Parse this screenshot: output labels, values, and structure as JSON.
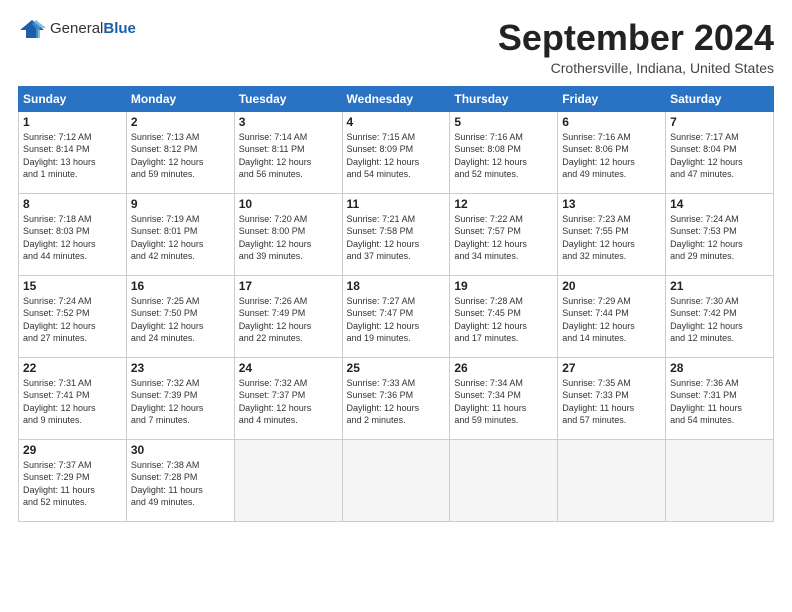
{
  "header": {
    "logo_general": "General",
    "logo_blue": "Blue",
    "month_title": "September 2024",
    "location": "Crothersville, Indiana, United States"
  },
  "weekdays": [
    "Sunday",
    "Monday",
    "Tuesday",
    "Wednesday",
    "Thursday",
    "Friday",
    "Saturday"
  ],
  "weeks": [
    [
      {
        "day": "1",
        "info": "Sunrise: 7:12 AM\nSunset: 8:14 PM\nDaylight: 13 hours\nand 1 minute."
      },
      {
        "day": "2",
        "info": "Sunrise: 7:13 AM\nSunset: 8:12 PM\nDaylight: 12 hours\nand 59 minutes."
      },
      {
        "day": "3",
        "info": "Sunrise: 7:14 AM\nSunset: 8:11 PM\nDaylight: 12 hours\nand 56 minutes."
      },
      {
        "day": "4",
        "info": "Sunrise: 7:15 AM\nSunset: 8:09 PM\nDaylight: 12 hours\nand 54 minutes."
      },
      {
        "day": "5",
        "info": "Sunrise: 7:16 AM\nSunset: 8:08 PM\nDaylight: 12 hours\nand 52 minutes."
      },
      {
        "day": "6",
        "info": "Sunrise: 7:16 AM\nSunset: 8:06 PM\nDaylight: 12 hours\nand 49 minutes."
      },
      {
        "day": "7",
        "info": "Sunrise: 7:17 AM\nSunset: 8:04 PM\nDaylight: 12 hours\nand 47 minutes."
      }
    ],
    [
      {
        "day": "8",
        "info": "Sunrise: 7:18 AM\nSunset: 8:03 PM\nDaylight: 12 hours\nand 44 minutes."
      },
      {
        "day": "9",
        "info": "Sunrise: 7:19 AM\nSunset: 8:01 PM\nDaylight: 12 hours\nand 42 minutes."
      },
      {
        "day": "10",
        "info": "Sunrise: 7:20 AM\nSunset: 8:00 PM\nDaylight: 12 hours\nand 39 minutes."
      },
      {
        "day": "11",
        "info": "Sunrise: 7:21 AM\nSunset: 7:58 PM\nDaylight: 12 hours\nand 37 minutes."
      },
      {
        "day": "12",
        "info": "Sunrise: 7:22 AM\nSunset: 7:57 PM\nDaylight: 12 hours\nand 34 minutes."
      },
      {
        "day": "13",
        "info": "Sunrise: 7:23 AM\nSunset: 7:55 PM\nDaylight: 12 hours\nand 32 minutes."
      },
      {
        "day": "14",
        "info": "Sunrise: 7:24 AM\nSunset: 7:53 PM\nDaylight: 12 hours\nand 29 minutes."
      }
    ],
    [
      {
        "day": "15",
        "info": "Sunrise: 7:24 AM\nSunset: 7:52 PM\nDaylight: 12 hours\nand 27 minutes."
      },
      {
        "day": "16",
        "info": "Sunrise: 7:25 AM\nSunset: 7:50 PM\nDaylight: 12 hours\nand 24 minutes."
      },
      {
        "day": "17",
        "info": "Sunrise: 7:26 AM\nSunset: 7:49 PM\nDaylight: 12 hours\nand 22 minutes."
      },
      {
        "day": "18",
        "info": "Sunrise: 7:27 AM\nSunset: 7:47 PM\nDaylight: 12 hours\nand 19 minutes."
      },
      {
        "day": "19",
        "info": "Sunrise: 7:28 AM\nSunset: 7:45 PM\nDaylight: 12 hours\nand 17 minutes."
      },
      {
        "day": "20",
        "info": "Sunrise: 7:29 AM\nSunset: 7:44 PM\nDaylight: 12 hours\nand 14 minutes."
      },
      {
        "day": "21",
        "info": "Sunrise: 7:30 AM\nSunset: 7:42 PM\nDaylight: 12 hours\nand 12 minutes."
      }
    ],
    [
      {
        "day": "22",
        "info": "Sunrise: 7:31 AM\nSunset: 7:41 PM\nDaylight: 12 hours\nand 9 minutes."
      },
      {
        "day": "23",
        "info": "Sunrise: 7:32 AM\nSunset: 7:39 PM\nDaylight: 12 hours\nand 7 minutes."
      },
      {
        "day": "24",
        "info": "Sunrise: 7:32 AM\nSunset: 7:37 PM\nDaylight: 12 hours\nand 4 minutes."
      },
      {
        "day": "25",
        "info": "Sunrise: 7:33 AM\nSunset: 7:36 PM\nDaylight: 12 hours\nand 2 minutes."
      },
      {
        "day": "26",
        "info": "Sunrise: 7:34 AM\nSunset: 7:34 PM\nDaylight: 11 hours\nand 59 minutes."
      },
      {
        "day": "27",
        "info": "Sunrise: 7:35 AM\nSunset: 7:33 PM\nDaylight: 11 hours\nand 57 minutes."
      },
      {
        "day": "28",
        "info": "Sunrise: 7:36 AM\nSunset: 7:31 PM\nDaylight: 11 hours\nand 54 minutes."
      }
    ],
    [
      {
        "day": "29",
        "info": "Sunrise: 7:37 AM\nSunset: 7:29 PM\nDaylight: 11 hours\nand 52 minutes."
      },
      {
        "day": "30",
        "info": "Sunrise: 7:38 AM\nSunset: 7:28 PM\nDaylight: 11 hours\nand 49 minutes."
      },
      {
        "day": "",
        "info": ""
      },
      {
        "day": "",
        "info": ""
      },
      {
        "day": "",
        "info": ""
      },
      {
        "day": "",
        "info": ""
      },
      {
        "day": "",
        "info": ""
      }
    ]
  ]
}
